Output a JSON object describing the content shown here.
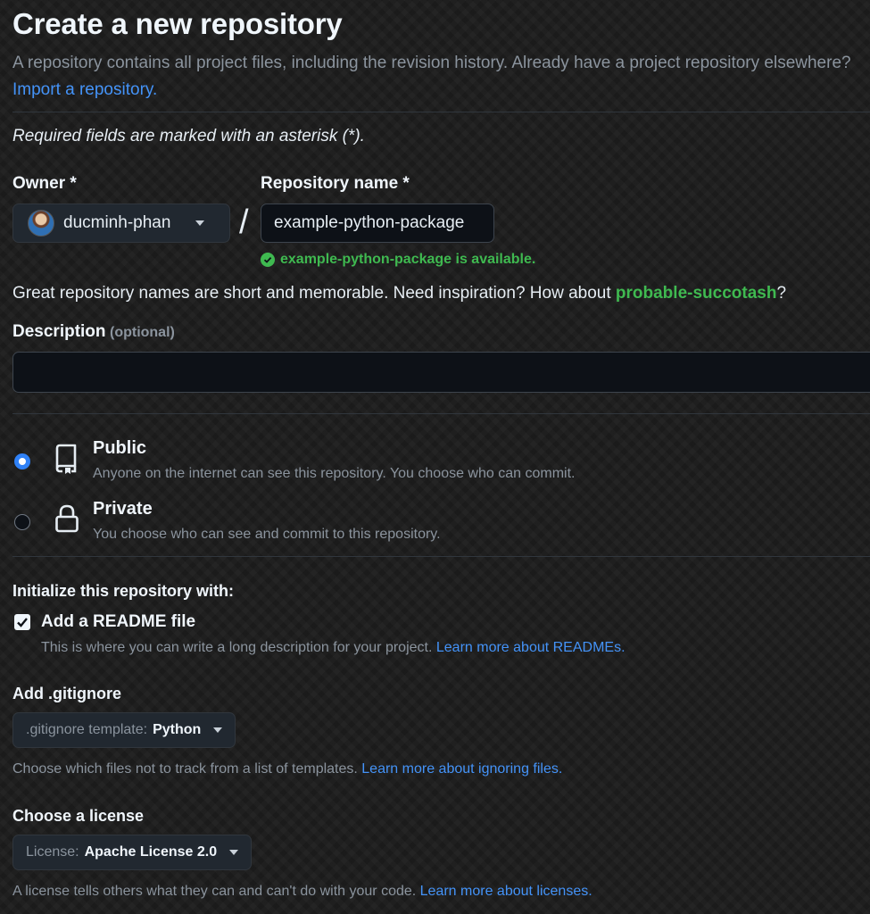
{
  "header": {
    "title": "Create a new repository",
    "subtitle": "A repository contains all project files, including the revision history. Already have a project repository elsewhere?",
    "import_link": "Import a repository."
  },
  "required_note": "Required fields are marked with an asterisk (*).",
  "owner": {
    "label": "Owner *",
    "value": "ducminh-phan"
  },
  "repository": {
    "label": "Repository name *",
    "value": "example-python-package",
    "availability": "example-python-package is available."
  },
  "suggestion": {
    "text": "Great repository names are short and memorable. Need inspiration? How about",
    "name": "probable-succotash",
    "suffix": "?"
  },
  "description": {
    "label": "Description",
    "optional": "(optional)",
    "value": ""
  },
  "visibility": {
    "public": {
      "title": "Public",
      "desc": "Anyone on the internet can see this repository. You choose who can commit.",
      "selected": true
    },
    "private": {
      "title": "Private",
      "desc": "You choose who can see and commit to this repository.",
      "selected": false
    }
  },
  "initialize": {
    "title": "Initialize this repository with:",
    "readme": {
      "label": "Add a README file",
      "checked": true,
      "help": "This is where you can write a long description for your project.",
      "link": "Learn more about READMEs."
    }
  },
  "gitignore": {
    "title": "Add .gitignore",
    "select_prefix": ".gitignore template:",
    "select_value": "Python",
    "help": "Choose which files not to track from a list of templates.",
    "link": "Learn more about ignoring files."
  },
  "license": {
    "title": "Choose a license",
    "select_prefix": "License:",
    "select_value": "Apache License 2.0",
    "help": "A license tells others what they can and can't do with your code.",
    "link": "Learn more about licenses."
  },
  "colors": {
    "link": "#4493f8",
    "success": "#3fb950",
    "radio_selected": "#2f81f7"
  }
}
